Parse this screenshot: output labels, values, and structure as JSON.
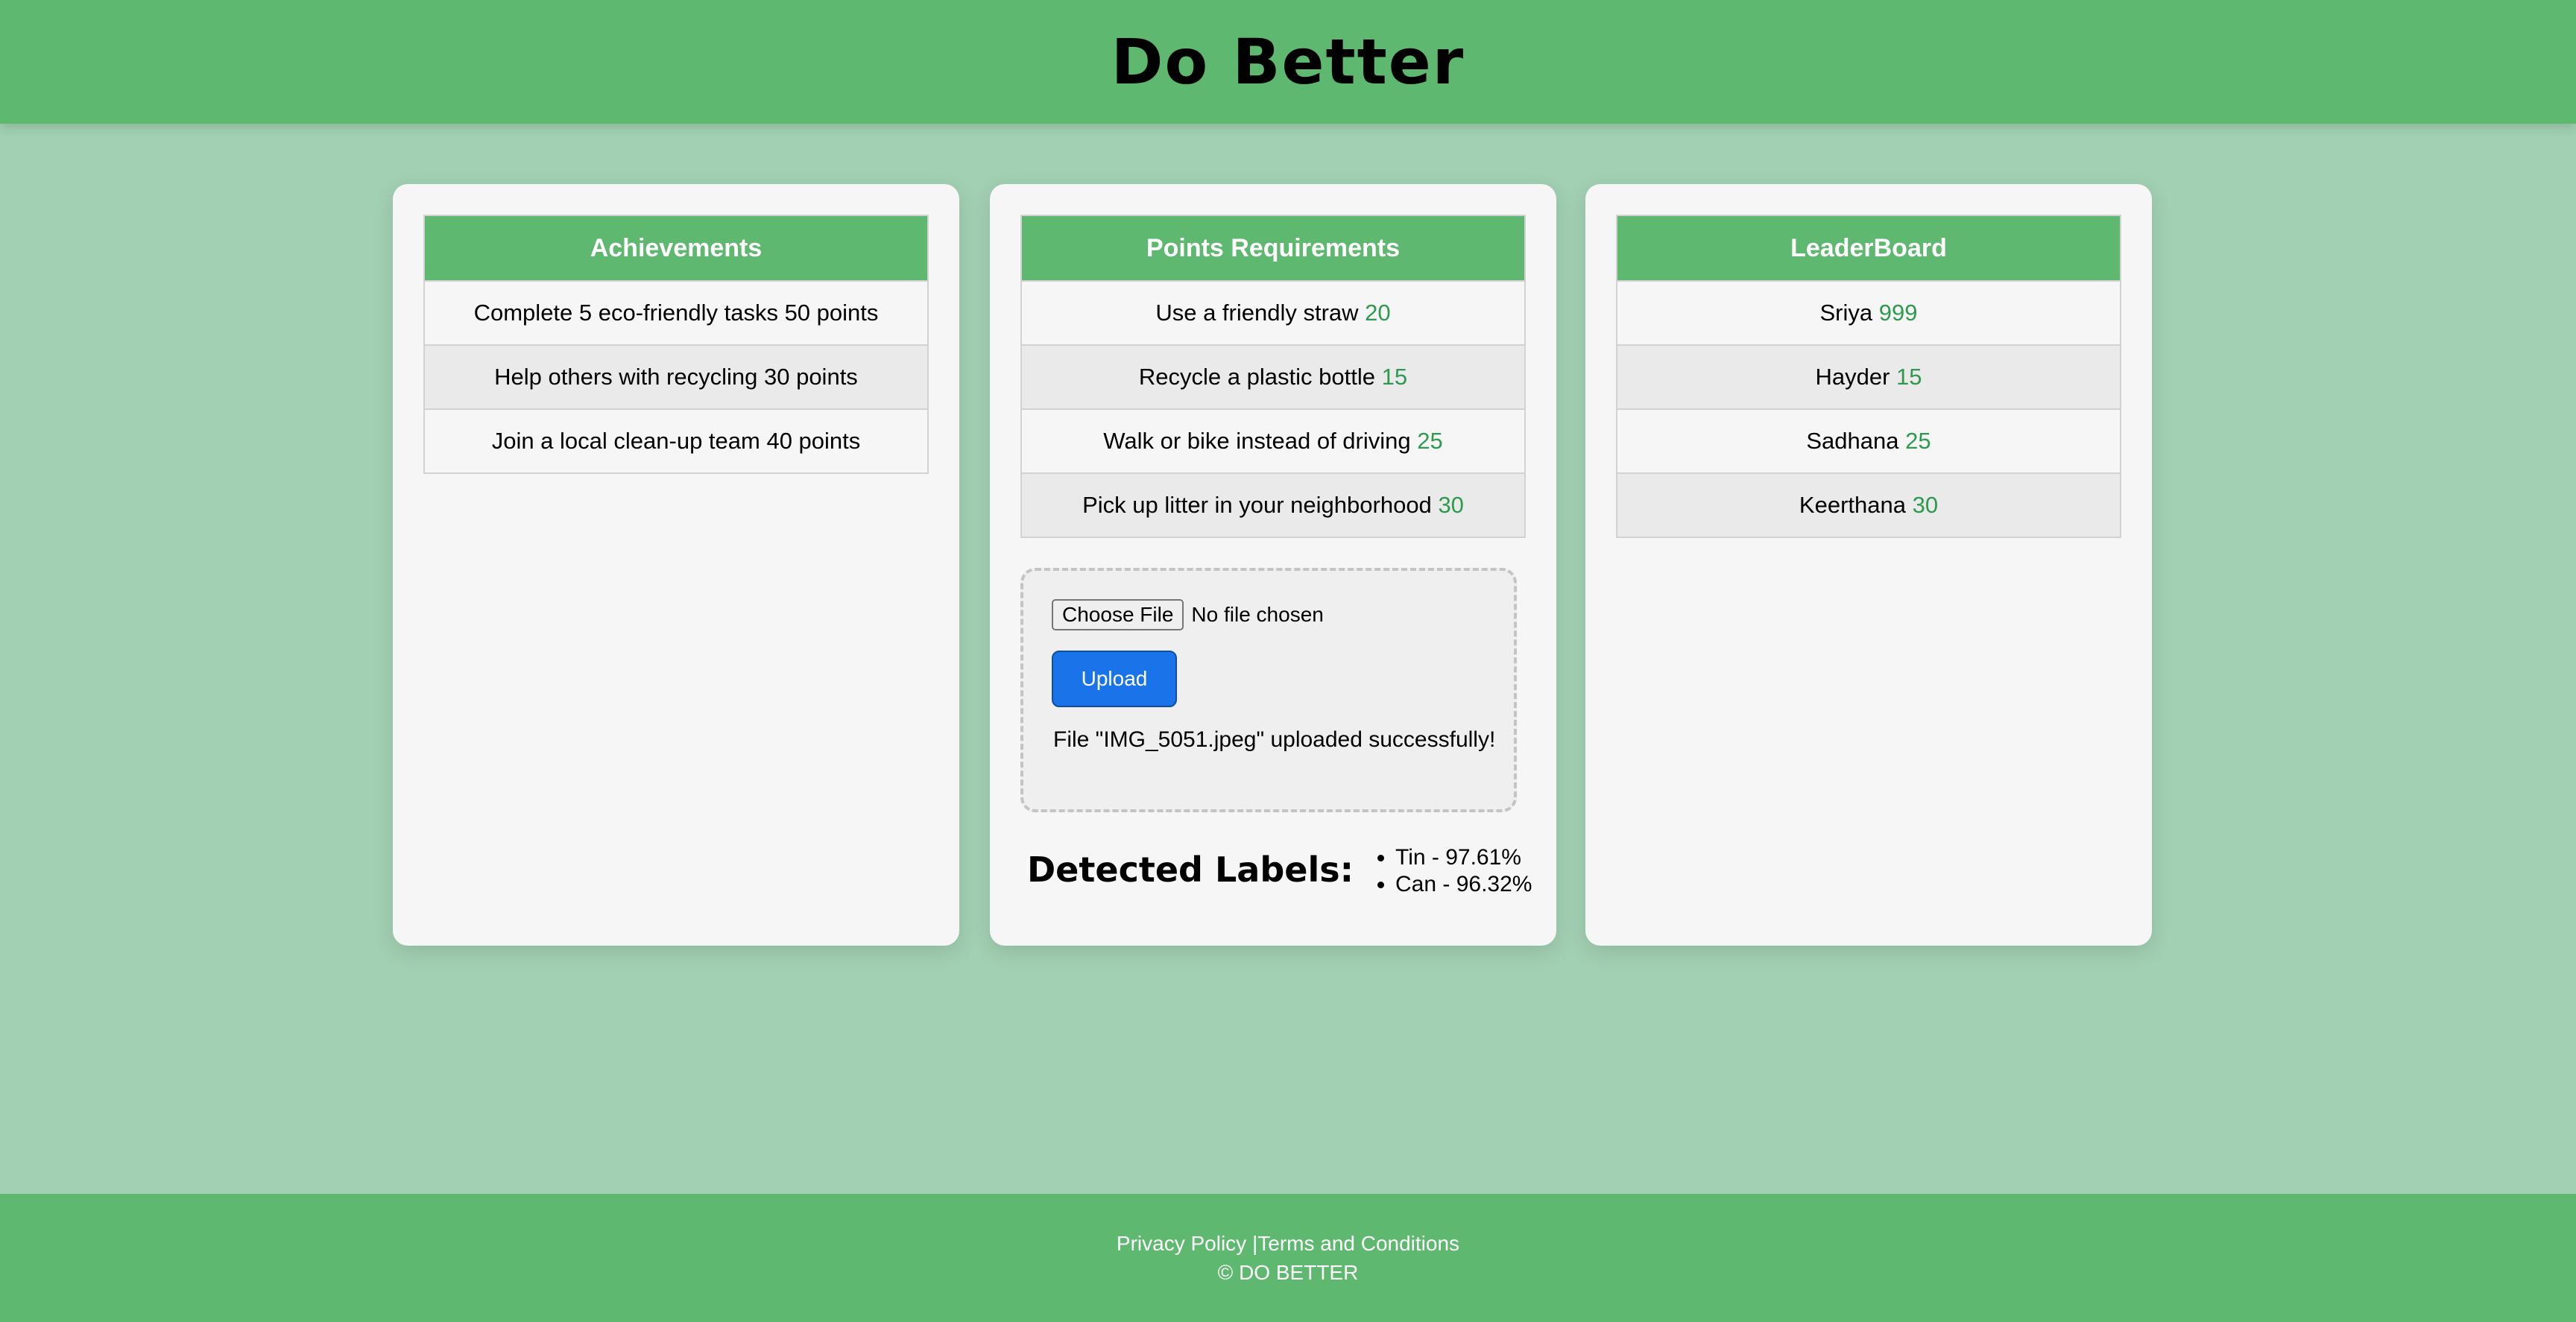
{
  "header": {
    "title": "Do Better"
  },
  "achievements": {
    "header": "Achievements",
    "rows": [
      "Complete 5 eco-friendly tasks 50 points",
      "Help others with recycling 30 points",
      "Join a local clean-up team 40 points"
    ]
  },
  "points": {
    "header": "Points Requirements",
    "rows": [
      {
        "task": "Use a friendly straw",
        "points": "20"
      },
      {
        "task": "Recycle a plastic bottle",
        "points": "15"
      },
      {
        "task": "Walk or bike instead of driving",
        "points": "25"
      },
      {
        "task": "Pick up litter in your neighborhood",
        "points": "30"
      }
    ]
  },
  "upload": {
    "choose_label": "Choose File",
    "no_file_text": "No file chosen",
    "upload_label": "Upload",
    "message": "File \"IMG_5051.jpeg\" uploaded successfully!"
  },
  "detected": {
    "title": "Detected Labels:",
    "labels": [
      "Tin - 97.61%",
      "Can - 96.32%"
    ]
  },
  "leaderboard": {
    "header": "LeaderBoard",
    "rows": [
      {
        "name": "Sriya",
        "points": "999"
      },
      {
        "name": "Hayder",
        "points": "15"
      },
      {
        "name": "Sadhana",
        "points": "25"
      },
      {
        "name": "Keerthana",
        "points": "30"
      }
    ]
  },
  "footer": {
    "privacy": "Privacy Policy",
    "separator": "|",
    "terms": "Terms and Conditions",
    "copyright": "© DO BETTER"
  },
  "colors": {
    "brand_green": "#5eb86f",
    "page_background": "#a2d0b3",
    "points_text": "#2e9a4e",
    "upload_button": "#1a73e8"
  }
}
